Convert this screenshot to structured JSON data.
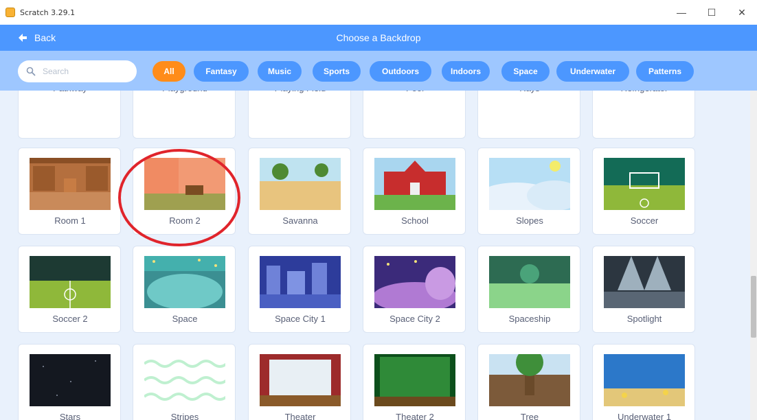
{
  "window": {
    "title": "Scratch 3.29.1",
    "minimize": "—",
    "maximize": "☐",
    "close": "✕"
  },
  "header": {
    "back_label": "Back",
    "title": "Choose a Backdrop"
  },
  "search": {
    "placeholder": "Search",
    "value": ""
  },
  "tags": [
    {
      "label": "All",
      "active": true
    },
    {
      "label": "Fantasy",
      "active": false
    },
    {
      "label": "Music",
      "active": false
    },
    {
      "label": "Sports",
      "active": false
    },
    {
      "label": "Outdoors",
      "active": false
    },
    {
      "label": "Indoors",
      "active": false
    },
    {
      "label": "Space",
      "active": false
    },
    {
      "label": "Underwater",
      "active": false
    },
    {
      "label": "Patterns",
      "active": false
    }
  ],
  "backdrops": [
    {
      "name": "Pathway",
      "icon": "pathway-thumbnail"
    },
    {
      "name": "Playground",
      "icon": "playground-thumbnail"
    },
    {
      "name": "Playing Field",
      "icon": "playing-field-thumbnail"
    },
    {
      "name": "Pool",
      "icon": "pool-thumbnail"
    },
    {
      "name": "Rays",
      "icon": "rays-thumbnail"
    },
    {
      "name": "Refrigerator",
      "icon": "refrigerator-thumbnail"
    },
    {
      "name": "Room 1",
      "icon": "room-1-thumbnail"
    },
    {
      "name": "Room 2",
      "icon": "room-2-thumbnail"
    },
    {
      "name": "Savanna",
      "icon": "savanna-thumbnail"
    },
    {
      "name": "School",
      "icon": "school-thumbnail"
    },
    {
      "name": "Slopes",
      "icon": "slopes-thumbnail"
    },
    {
      "name": "Soccer",
      "icon": "soccer-thumbnail"
    },
    {
      "name": "Soccer 2",
      "icon": "soccer-2-thumbnail"
    },
    {
      "name": "Space",
      "icon": "space-thumbnail",
      "highlighted": true
    },
    {
      "name": "Space City 1",
      "icon": "space-city-1-thumbnail"
    },
    {
      "name": "Space City 2",
      "icon": "space-city-2-thumbnail"
    },
    {
      "name": "Spaceship",
      "icon": "spaceship-thumbnail"
    },
    {
      "name": "Spotlight",
      "icon": "spotlight-thumbnail"
    },
    {
      "name": "Stars",
      "icon": "stars-thumbnail"
    },
    {
      "name": "Stripes",
      "icon": "stripes-thumbnail"
    },
    {
      "name": "Theater",
      "icon": "theater-thumbnail"
    },
    {
      "name": "Theater 2",
      "icon": "theater-2-thumbnail"
    },
    {
      "name": "Tree",
      "icon": "tree-thumbnail"
    },
    {
      "name": "Underwater 1",
      "icon": "underwater-1-thumbnail"
    }
  ],
  "colors": {
    "header_blue": "#4c97ff",
    "filter_bar": "#9ec7ff",
    "active_tag": "#ff8c1a",
    "highlight_ring": "#e0242b"
  }
}
